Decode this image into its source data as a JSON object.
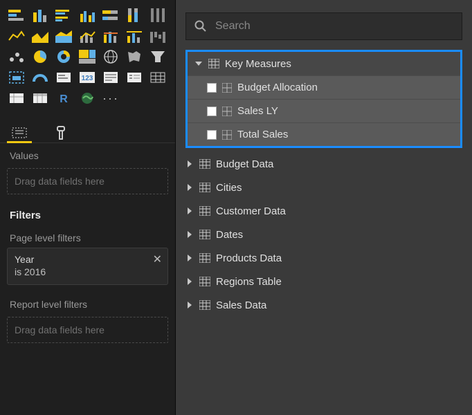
{
  "search": {
    "placeholder": "Search"
  },
  "leftPanel": {
    "valuesLabel": "Values",
    "valuesPlaceholder": "Drag data fields here",
    "filtersHeading": "Filters",
    "pageFiltersLabel": "Page level filters",
    "filterCard": {
      "field": "Year",
      "condition": "is 2016"
    },
    "reportFiltersLabel": "Report level filters",
    "reportFiltersPlaceholder": "Drag data fields here"
  },
  "fields": {
    "highlight": {
      "group": "Key Measures",
      "items": [
        "Budget Allocation",
        "Sales LY",
        "Total Sales"
      ]
    },
    "tables": [
      "Budget Data",
      "Cities",
      "Customer Data",
      "Dates",
      "Products Data",
      "Regions Table",
      "Sales Data"
    ]
  }
}
